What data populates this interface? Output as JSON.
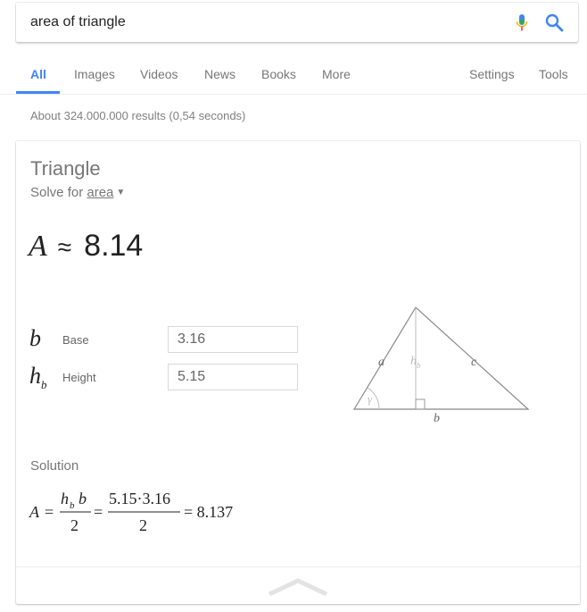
{
  "search": {
    "query": "area of triangle"
  },
  "tabs": {
    "all": "All",
    "images": "Images",
    "videos": "Videos",
    "news": "News",
    "books": "Books",
    "more": "More",
    "settings": "Settings",
    "tools": "Tools"
  },
  "stats": "About 324.000.000 results (0,54 seconds)",
  "card": {
    "title": "Triangle",
    "solve_prefix": "Solve for",
    "solve_target": "area",
    "result": {
      "variable": "A",
      "approx": "≈",
      "value": "8.14"
    },
    "fields": [
      {
        "symbol": "b",
        "subscript": "",
        "label": "Base",
        "value": "3.16"
      },
      {
        "symbol": "h",
        "subscript": "b",
        "label": "Height",
        "value": "5.15"
      }
    ],
    "diagram": {
      "side_a": "a",
      "side_c": "c",
      "side_b": "b",
      "height": "h",
      "height_sub": "b",
      "angle": "γ"
    },
    "solution_label": "Solution",
    "solution": {
      "lhs": "A",
      "eq": "=",
      "num_h": "h",
      "num_sub": "b",
      "num_b": "b",
      "den": "2",
      "num2": "5.15·3.16",
      "den2": "2",
      "result": "= 8.137"
    }
  },
  "colors": {
    "accent": "#4285f4",
    "text_muted": "#777777"
  },
  "icons": {
    "mic": "microphone-icon",
    "search": "search-icon",
    "collapse": "chevron-up-icon",
    "dropdown": "caret-down-icon"
  }
}
